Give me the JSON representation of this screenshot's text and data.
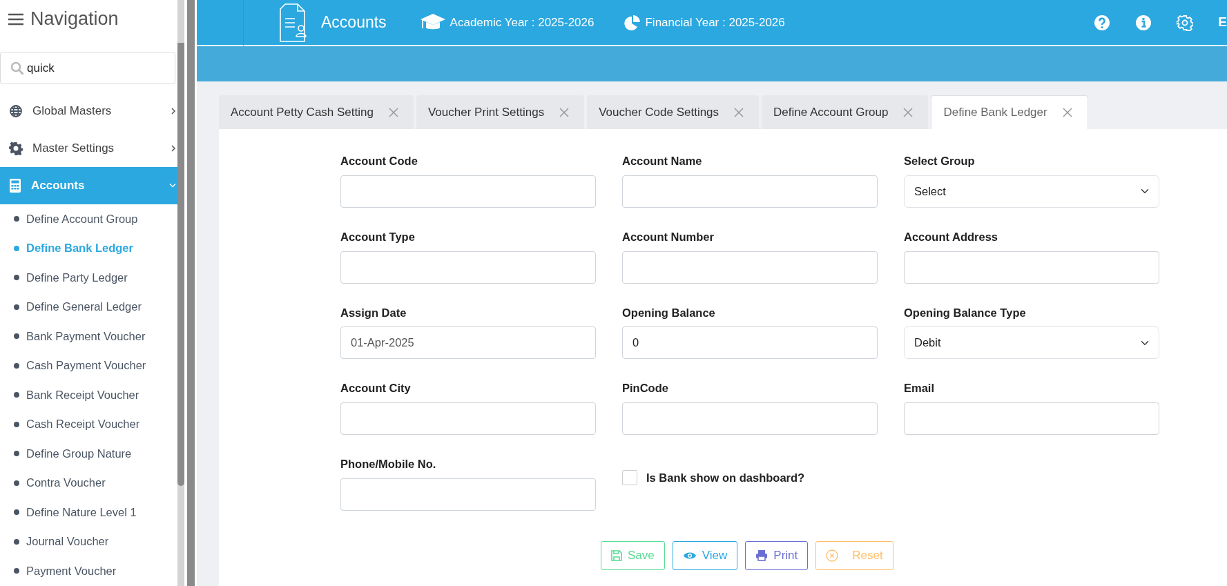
{
  "sidebar": {
    "title": "Navigation",
    "search": {
      "value": "quick"
    },
    "menu": [
      {
        "label": "Global Masters",
        "expanded": false,
        "selected": false
      },
      {
        "label": "Master Settings",
        "expanded": false,
        "selected": false
      },
      {
        "label": "Accounts",
        "expanded": true,
        "selected": true,
        "children": [
          {
            "label": "Define Account Group",
            "selected": false
          },
          {
            "label": "Define Bank Ledger",
            "selected": true
          },
          {
            "label": "Define Party Ledger",
            "selected": false
          },
          {
            "label": "Define General Ledger",
            "selected": false
          },
          {
            "label": "Bank Payment Voucher",
            "selected": false
          },
          {
            "label": "Cash Payment Voucher",
            "selected": false
          },
          {
            "label": "Bank Receipt Voucher",
            "selected": false
          },
          {
            "label": "Cash Receipt Voucher",
            "selected": false
          },
          {
            "label": "Define Group Nature",
            "selected": false
          },
          {
            "label": "Contra Voucher",
            "selected": false
          },
          {
            "label": "Define Nature Level 1",
            "selected": false
          },
          {
            "label": "Journal Voucher",
            "selected": false
          },
          {
            "label": "Payment Voucher",
            "selected": false
          }
        ]
      }
    ]
  },
  "topbar": {
    "module": "Accounts",
    "academic_year": "Academic Year : 2025-2026",
    "financial_year": "Financial Year : 2025-2026",
    "user_initial": "E"
  },
  "tabs": [
    {
      "label": "Account Petty Cash Setting",
      "selected": false
    },
    {
      "label": "Voucher Print Settings",
      "selected": false
    },
    {
      "label": "Voucher Code Settings",
      "selected": false
    },
    {
      "label": "Define Account Group",
      "selected": false
    },
    {
      "label": "Define Bank Ledger",
      "selected": true
    }
  ],
  "form": {
    "fields": [
      {
        "label": "Account Code",
        "kind": "text"
      },
      {
        "label": "Account Name",
        "kind": "text"
      },
      {
        "label": "Select Group",
        "kind": "select",
        "value": "Select"
      },
      {
        "label": "Account Type",
        "kind": "text"
      },
      {
        "label": "Account Number",
        "kind": "text"
      },
      {
        "label": "Account Address",
        "kind": "text"
      },
      {
        "label": "Assign Date",
        "kind": "date",
        "value": "01-Apr-2025"
      },
      {
        "label": "Opening Balance",
        "kind": "text",
        "value": "0"
      },
      {
        "label": "Opening Balance Type",
        "kind": "select",
        "value": "Debit"
      },
      {
        "label": "Account City",
        "kind": "text"
      },
      {
        "label": "PinCode",
        "kind": "text"
      },
      {
        "label": "Email",
        "kind": "text"
      },
      {
        "label": "Phone/Mobile No.",
        "kind": "text"
      },
      {
        "label": "Is Bank show on dashboard?",
        "kind": "checkbox",
        "checked": false
      }
    ],
    "buttons": [
      {
        "label": "Save",
        "kind": "save"
      },
      {
        "label": "View",
        "kind": "view"
      },
      {
        "label": "Print",
        "kind": "print"
      },
      {
        "label": "Reset",
        "kind": "reset"
      }
    ]
  }
}
